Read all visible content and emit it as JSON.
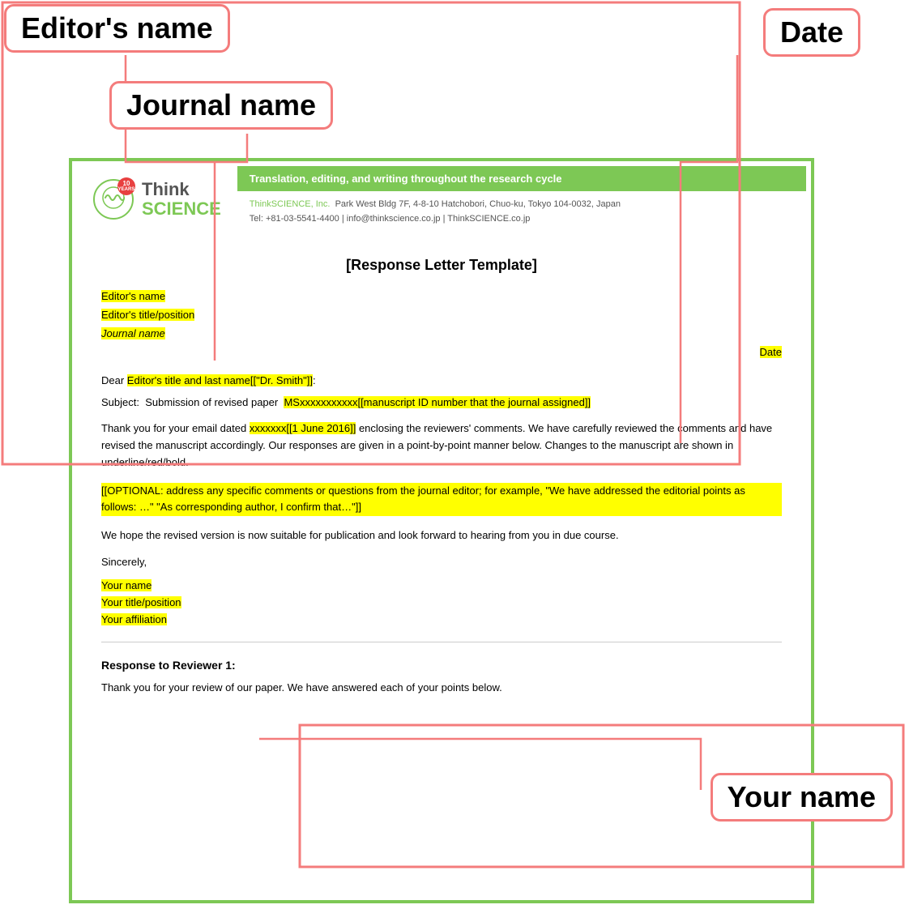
{
  "labels": {
    "editors_name": "Editor's name",
    "date": "Date",
    "journal_name": "Journal name",
    "your_name": "Your name"
  },
  "header": {
    "tagline": "Translation, editing, and writing throughout the research cycle",
    "company": "ThinkSCIENCE, Inc.",
    "address": "Park West Bldg 7F, 4-8-10 Hatchobori, Chuo-ku, Tokyo 104-0032, Japan",
    "tel": "Tel: +81-03-5541-4400",
    "email": "info@thinkscience.co.jp",
    "website": "ThinkSCIENCE.co.jp",
    "logo_name": "Think SCIENCE",
    "years": "10 YEARS"
  },
  "letter": {
    "title": "[Response Letter Template]",
    "editors_name": "Editor's name",
    "editors_title": "Editor's title/position",
    "journal_name": "Journal name",
    "date": "Date",
    "dear": "Dear Editor's title and last name[[\"Dr. Smith\"]]:",
    "subject_prefix": "Subject:  Submission of revised paper  ",
    "subject_highlight": "MSxxxxxxxxxxx[[manuscript ID number that the journal assigned]]",
    "para1_prefix": "Thank you for your email dated ",
    "para1_date": "xxxxxxx[[1 June 2016]]",
    "para1_suffix": " enclosing the reviewers' comments. We have carefully reviewed the comments and have revised the manuscript accordingly. Our responses are given in a point-by-point manner below. Changes to the manuscript are shown in underline/red/bold.",
    "optional": "[[OPTIONAL: address any specific comments or questions from the journal editor; for example, \"We have addressed the editorial points as follows: …\" \"As corresponding author, I confirm that…\"]]",
    "closing_para": "We hope the revised version is now suitable for publication and look forward to hearing from you in due course.",
    "sincerely": "Sincerely,",
    "your_name": "Your name",
    "your_title": "Your title/position",
    "your_affiliation": "Your affiliation",
    "response_title": "Response to Reviewer 1:",
    "response_para": "Thank you for your review of our paper. We have answered each of your points below."
  }
}
